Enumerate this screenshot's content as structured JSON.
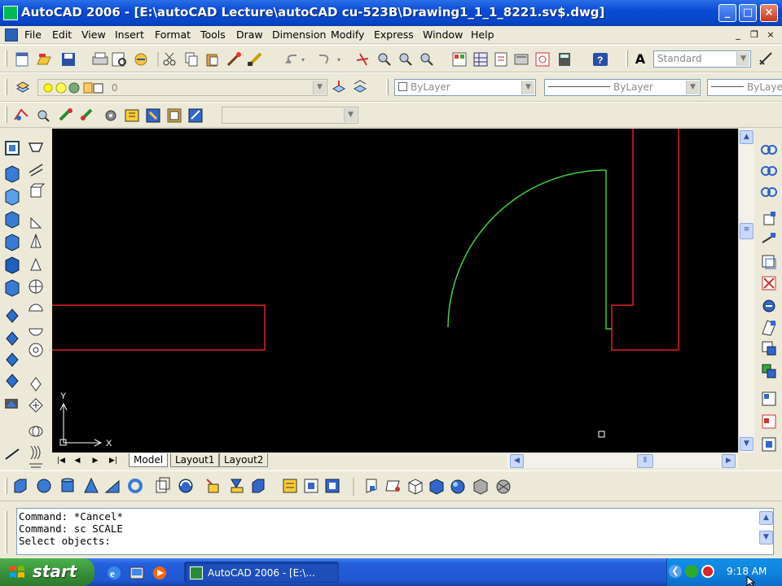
{
  "window": {
    "title": "AutoCAD 2006 - [E:\\autoCAD Lecture\\autoCAD cu-523B\\Drawing1_1_1_8221.sv$.dwg]",
    "minimize": "_",
    "maximize": "□",
    "close": "×"
  },
  "menu": {
    "items": [
      "File",
      "Edit",
      "View",
      "Insert",
      "Format",
      "Tools",
      "Draw",
      "Dimension",
      "Modify",
      "Express",
      "Window",
      "Help"
    ],
    "mdi_minimize": "_",
    "mdi_restore": "❐",
    "mdi_close": "×"
  },
  "toolbars": {
    "text_style": "Standard",
    "layer_name": "0",
    "color": "ByLayer",
    "linetype": "ByLayer",
    "lineweight": "ByLaye"
  },
  "colors": {
    "canvas": "#000000",
    "red_geometry": "#e02020",
    "green_geometry": "#3ccf3c"
  },
  "canvas": {
    "ucs_x_label": "X",
    "ucs_y_label": "Y"
  },
  "layout_tabs": {
    "items": [
      "Model",
      "Layout1",
      "Layout2"
    ],
    "active": "Model"
  },
  "command": {
    "lines": [
      "Command: *Cancel*",
      "Command: sc SCALE",
      "Select objects:"
    ]
  },
  "taskbar": {
    "start_label": "start",
    "app_button": "AutoCAD 2006 - [E:\\...",
    "clock": "9:18 AM"
  }
}
